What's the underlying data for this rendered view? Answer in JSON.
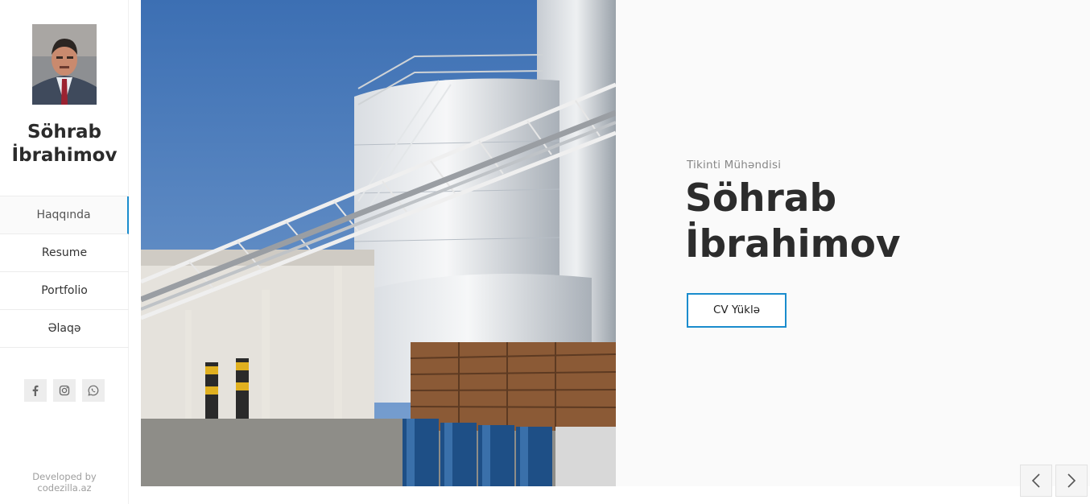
{
  "sidebar": {
    "name": "Söhrab İbrahimov",
    "nav": [
      {
        "label": "Haqqında",
        "active": true
      },
      {
        "label": "Resume",
        "active": false
      },
      {
        "label": "Portfolio",
        "active": false
      },
      {
        "label": "Əlaqə",
        "active": false
      }
    ],
    "social": [
      {
        "icon": "facebook-icon"
      },
      {
        "icon": "instagram-icon"
      },
      {
        "icon": "whatsapp-icon"
      }
    ],
    "credits_line1": "Developed by",
    "credits_line2": "codezilla.az"
  },
  "hero": {
    "subtitle": "Tikinti Mühəndisi",
    "title_line1": "Söhrab",
    "title_line2": "İbrahimov",
    "cv_button": "CV Yüklə"
  },
  "slider": {
    "prev_icon": "chevron-left-icon",
    "next_icon": "chevron-right-icon"
  },
  "colors": {
    "accent": "#1a8ccd",
    "text_dark": "#2c2c2c",
    "panel_bg": "#fafafa"
  }
}
